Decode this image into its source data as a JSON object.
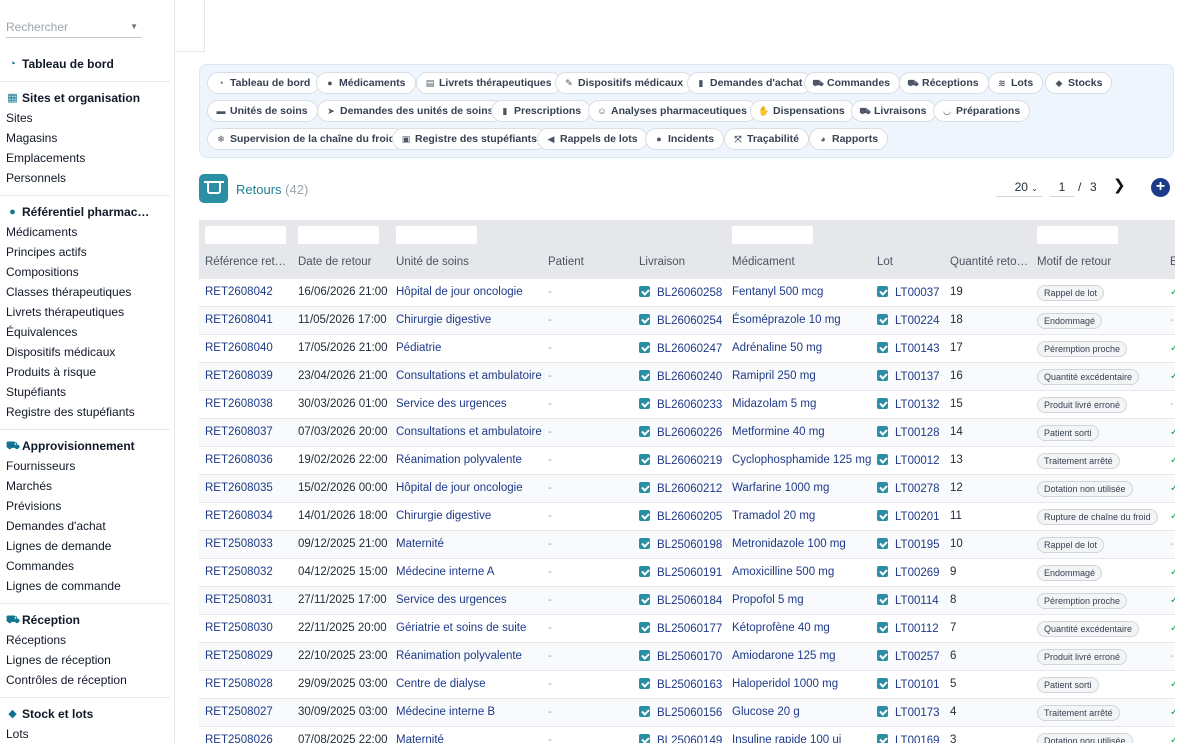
{
  "sidebar": {
    "search_placeholder": "Rechercher",
    "dashboard": "Tableau de bord",
    "sections": [
      {
        "title": "Sites et organisation",
        "icon": "building-icon",
        "items": [
          "Sites",
          "Magasins",
          "Emplacements",
          "Personnels"
        ]
      },
      {
        "title": "Référentiel pharmac…",
        "icon": "pills-icon",
        "items": [
          "Médicaments",
          "Principes actifs",
          "Compositions",
          "Classes thérapeutiques",
          "Livrets thérapeutiques",
          "Équivalences",
          "Dispositifs médicaux",
          "Produits à risque",
          "Stupéfiants",
          "Registre des stupéfiants"
        ]
      },
      {
        "title": "Approvisionnement",
        "icon": "cart-icon",
        "items": [
          "Fournisseurs",
          "Marchés",
          "Prévisions",
          "Demandes d'achat",
          "Lignes de demande",
          "Commandes",
          "Lignes de commande"
        ]
      },
      {
        "title": "Réception",
        "icon": "truck-icon",
        "items": [
          "Réceptions",
          "Lignes de réception",
          "Contrôles de réception"
        ]
      },
      {
        "title": "Stock et lots",
        "icon": "cubes-icon",
        "items": [
          "Lots"
        ]
      }
    ]
  },
  "modules": [
    {
      "label": "Tableau de bord",
      "icon": "gauge-icon"
    },
    {
      "label": "Médicaments",
      "icon": "pills-icon"
    },
    {
      "label": "Livrets thérapeutiques",
      "icon": "book-icon"
    },
    {
      "label": "Dispositifs médicaux",
      "icon": "syringe-icon"
    },
    {
      "label": "Demandes d'achat",
      "icon": "file-icon"
    },
    {
      "label": "Commandes",
      "icon": "cart-icon"
    },
    {
      "label": "Réceptions",
      "icon": "truck-ramp-icon"
    },
    {
      "label": "Lots",
      "icon": "layers-icon"
    },
    {
      "label": "Stocks",
      "icon": "cubes-icon"
    },
    {
      "label": "Unités de soins",
      "icon": "bed-icon"
    },
    {
      "label": "Demandes des unités de soins",
      "icon": "send-icon"
    },
    {
      "label": "Prescriptions",
      "icon": "prescription-icon"
    },
    {
      "label": "Analyses pharmaceutiques",
      "icon": "user-check-icon"
    },
    {
      "label": "Dispensations",
      "icon": "hand-icon"
    },
    {
      "label": "Livraisons",
      "icon": "truck-icon"
    },
    {
      "label": "Préparations",
      "icon": "mortar-icon"
    },
    {
      "label": "Supervision de la chaîne du froid",
      "icon": "snowflake-icon"
    },
    {
      "label": "Registre des stupéfiants",
      "icon": "lock-icon"
    },
    {
      "label": "Rappels de lots",
      "icon": "megaphone-icon"
    },
    {
      "label": "Incidents",
      "icon": "alert-icon"
    },
    {
      "label": "Traçabilité",
      "icon": "route-icon"
    },
    {
      "label": "Rapports",
      "icon": "chart-pie-icon"
    }
  ],
  "page": {
    "title": "Retours",
    "count": "(42)"
  },
  "pager": {
    "page_size": "20",
    "current_page": "1",
    "separator": "/",
    "total_pages": "3"
  },
  "table": {
    "columns": [
      "Référence ret…",
      "Date de retour",
      "Unité de soins",
      "Patient",
      "Livraison",
      "Médicament",
      "Lot",
      "Quantité reto…",
      "Motif de retour",
      "E"
    ],
    "rows": [
      {
        "ref": "RET2608042",
        "date": "16/06/2026 21:00",
        "unit": "Hôpital de jour oncologie",
        "patient": "-",
        "livraison": "BL26060258",
        "med": "Fentanyl 500 mcg",
        "lot": "LT00037",
        "qty": "19",
        "motif": "Rappel de lot",
        "e": "✓"
      },
      {
        "ref": "RET2608041",
        "date": "11/05/2026 17:00",
        "unit": "Chirurgie digestive",
        "patient": "-",
        "livraison": "BL26060254",
        "med": "Ésoméprazole 10 mg",
        "lot": "LT00224",
        "qty": "18",
        "motif": "Endommagé",
        "e": "-"
      },
      {
        "ref": "RET2608040",
        "date": "17/05/2026 21:00",
        "unit": "Pédiatrie",
        "patient": "-",
        "livraison": "BL26060247",
        "med": "Adrénaline 50 mg",
        "lot": "LT00143",
        "qty": "17",
        "motif": "Péremption proche",
        "e": "✓"
      },
      {
        "ref": "RET2608039",
        "date": "23/04/2026 21:00",
        "unit": "Consultations et ambulatoire",
        "patient": "-",
        "livraison": "BL26060240",
        "med": "Ramipril 250 mg",
        "lot": "LT00137",
        "qty": "16",
        "motif": "Quantité excédentaire",
        "e": "✓"
      },
      {
        "ref": "RET2608038",
        "date": "30/03/2026 01:00",
        "unit": "Service des urgences",
        "patient": "-",
        "livraison": "BL26060233",
        "med": "Midazolam 5 mg",
        "lot": "LT00132",
        "qty": "15",
        "motif": "Produit livré erroné",
        "e": "-"
      },
      {
        "ref": "RET2608037",
        "date": "07/03/2026 20:00",
        "unit": "Consultations et ambulatoire",
        "patient": "-",
        "livraison": "BL26060226",
        "med": "Metformine 40 mg",
        "lot": "LT00128",
        "qty": "14",
        "motif": "Patient sorti",
        "e": "✓"
      },
      {
        "ref": "RET2608036",
        "date": "19/02/2026 22:00",
        "unit": "Réanimation polyvalente",
        "patient": "-",
        "livraison": "BL26060219",
        "med": "Cyclophosphamide 125 mg",
        "lot": "LT00012",
        "qty": "13",
        "motif": "Traitement arrêté",
        "e": "✓"
      },
      {
        "ref": "RET2608035",
        "date": "15/02/2026 00:00",
        "unit": "Hôpital de jour oncologie",
        "patient": "-",
        "livraison": "BL26060212",
        "med": "Warfarine 1000 mg",
        "lot": "LT00278",
        "qty": "12",
        "motif": "Dotation non utilisée",
        "e": "✓"
      },
      {
        "ref": "RET2608034",
        "date": "14/01/2026 18:00",
        "unit": "Chirurgie digestive",
        "patient": "-",
        "livraison": "BL26060205",
        "med": "Tramadol 20 mg",
        "lot": "LT00201",
        "qty": "11",
        "motif": "Rupture de chaîne du froid",
        "e": "✓"
      },
      {
        "ref": "RET2508033",
        "date": "09/12/2025 21:00",
        "unit": "Maternité",
        "patient": "-",
        "livraison": "BL25060198",
        "med": "Metronidazole 100 mg",
        "lot": "LT00195",
        "qty": "10",
        "motif": "Rappel de lot",
        "e": "-"
      },
      {
        "ref": "RET2508032",
        "date": "04/12/2025 15:00",
        "unit": "Médecine interne A",
        "patient": "-",
        "livraison": "BL25060191",
        "med": "Amoxicilline 500 mg",
        "lot": "LT00269",
        "qty": "9",
        "motif": "Endommagé",
        "e": "✓"
      },
      {
        "ref": "RET2508031",
        "date": "27/11/2025 17:00",
        "unit": "Service des urgences",
        "patient": "-",
        "livraison": "BL25060184",
        "med": "Propofol 5 mg",
        "lot": "LT00114",
        "qty": "8",
        "motif": "Péremption proche",
        "e": "✓"
      },
      {
        "ref": "RET2508030",
        "date": "22/11/2025 20:00",
        "unit": "Gériatrie et soins de suite",
        "patient": "-",
        "livraison": "BL25060177",
        "med": "Kétoprofène 40 mg",
        "lot": "LT00112",
        "qty": "7",
        "motif": "Quantité excédentaire",
        "e": "✓"
      },
      {
        "ref": "RET2508029",
        "date": "22/10/2025 23:00",
        "unit": "Réanimation polyvalente",
        "patient": "-",
        "livraison": "BL25060170",
        "med": "Amiodarone 125 mg",
        "lot": "LT00257",
        "qty": "6",
        "motif": "Produit livré erroné",
        "e": "-"
      },
      {
        "ref": "RET2508028",
        "date": "29/09/2025 03:00",
        "unit": "Centre de dialyse",
        "patient": "-",
        "livraison": "BL25060163",
        "med": "Haloperidol 1000 mg",
        "lot": "LT00101",
        "qty": "5",
        "motif": "Patient sorti",
        "e": "✓"
      },
      {
        "ref": "RET2508027",
        "date": "30/09/2025 03:00",
        "unit": "Médecine interne B",
        "patient": "-",
        "livraison": "BL25060156",
        "med": "Glucose 20 g",
        "lot": "LT00173",
        "qty": "4",
        "motif": "Traitement arrêté",
        "e": "✓"
      },
      {
        "ref": "RET2508026",
        "date": "07/08/2025 22:00",
        "unit": "Maternité",
        "patient": "-",
        "livraison": "BL25060149",
        "med": "Insuline rapide 100 ui",
        "lot": "LT00169",
        "qty": "3",
        "motif": "Dotation non utilisée",
        "e": "✓"
      }
    ]
  },
  "colors": {
    "accent": "#2b8fa3",
    "link": "#1e3a8a",
    "check": "#16a34a"
  }
}
